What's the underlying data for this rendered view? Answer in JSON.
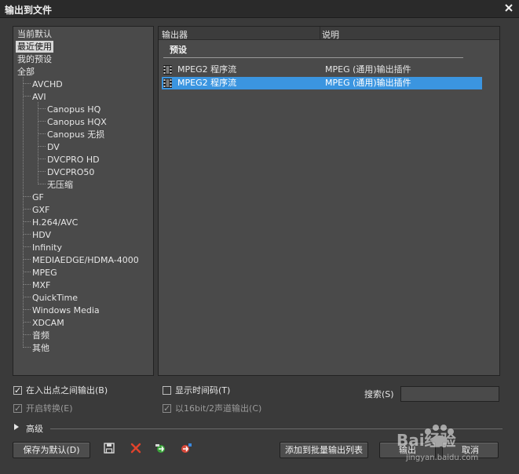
{
  "window": {
    "title": "输出到文件",
    "close_label": "X"
  },
  "tree": {
    "items": [
      {
        "label": "当前默认",
        "level": 0,
        "selected": false
      },
      {
        "label": "最近使用",
        "level": 0,
        "selected": true
      },
      {
        "label": "我的预设",
        "level": 0,
        "selected": false
      },
      {
        "label": "全部",
        "level": 0,
        "selected": false
      },
      {
        "label": "AVCHD",
        "level": 1,
        "selected": false
      },
      {
        "label": "AVI",
        "level": 1,
        "selected": false
      },
      {
        "label": "Canopus HQ",
        "level": 2,
        "selected": false
      },
      {
        "label": "Canopus HQX",
        "level": 2,
        "selected": false
      },
      {
        "label": "Canopus 无损",
        "level": 2,
        "selected": false
      },
      {
        "label": "DV",
        "level": 2,
        "selected": false
      },
      {
        "label": "DVCPRO HD",
        "level": 2,
        "selected": false
      },
      {
        "label": "DVCPRO50",
        "level": 2,
        "selected": false
      },
      {
        "label": "无压缩",
        "level": 2,
        "selected": false
      },
      {
        "label": "GF",
        "level": 1,
        "selected": false
      },
      {
        "label": "GXF",
        "level": 1,
        "selected": false
      },
      {
        "label": "H.264/AVC",
        "level": 1,
        "selected": false
      },
      {
        "label": "HDV",
        "level": 1,
        "selected": false
      },
      {
        "label": "Infinity",
        "level": 1,
        "selected": false
      },
      {
        "label": "MEDIAEDGE/HDMA-4000",
        "level": 1,
        "selected": false
      },
      {
        "label": "MPEG",
        "level": 1,
        "selected": false
      },
      {
        "label": "MXF",
        "level": 1,
        "selected": false
      },
      {
        "label": "QuickTime",
        "level": 1,
        "selected": false
      },
      {
        "label": "Windows Media",
        "level": 1,
        "selected": false
      },
      {
        "label": "XDCAM",
        "level": 1,
        "selected": false
      },
      {
        "label": "音频",
        "level": 1,
        "selected": false
      },
      {
        "label": "其他",
        "level": 1,
        "selected": false
      }
    ]
  },
  "list": {
    "col_exporter": "输出器",
    "col_description": "说明",
    "preset_label": "预设",
    "rows": [
      {
        "name": "MPEG2 程序流",
        "description": "MPEG (通用)输出插件",
        "selected": false
      },
      {
        "name": "MPEG2 程序流",
        "description": "MPEG (通用)输出插件",
        "selected": true
      }
    ]
  },
  "options": {
    "export_inout": {
      "label": "在入出点之间输出(B)",
      "checked": true,
      "disabled": false
    },
    "show_timecode": {
      "label": "显示时间码(T)",
      "checked": false,
      "disabled": false
    },
    "enable_convert": {
      "label": "开启转换(E)",
      "checked": true,
      "disabled": true
    },
    "output_16bit": {
      "label": "以16bit/2声道输出(C)",
      "checked": true,
      "disabled": true
    }
  },
  "search": {
    "label": "搜索(S)",
    "value": ""
  },
  "advanced": {
    "label": "高级"
  },
  "buttons": {
    "save_default": "保存为默认(D)",
    "add_batch": "添加到批量输出列表",
    "export": "输出",
    "cancel": "取消"
  },
  "watermark": {
    "text": "Bai经验",
    "sub": "jingyan.baidu.com"
  }
}
